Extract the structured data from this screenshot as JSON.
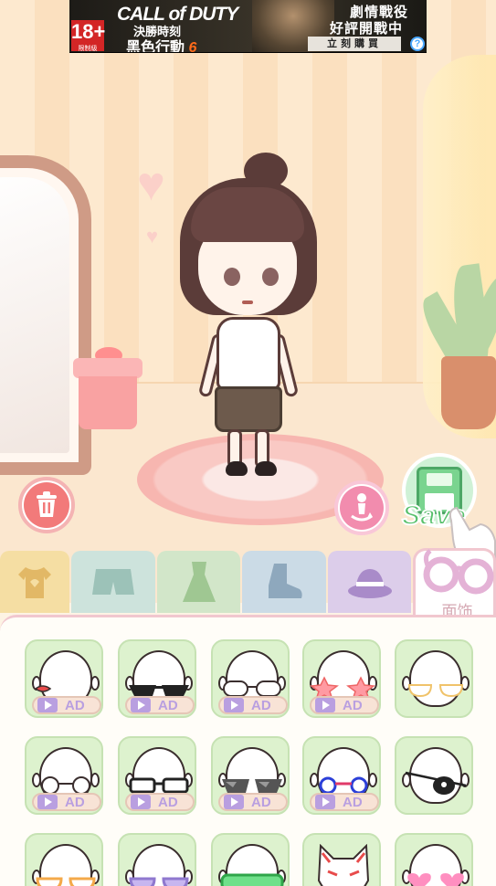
{
  "ad_banner": {
    "age_rating": "18+",
    "age_subtext": "限制級",
    "game_title": "CALL of DUTY",
    "game_subtitle": "決勝時刻",
    "game_line": "黑色行動",
    "game_number": "6",
    "tagline_1": "劇情戰役",
    "tagline_2": "好評開戰中",
    "cta": "立刻購買",
    "help": "?"
  },
  "actions": {
    "save_label": "Save"
  },
  "tabs": [
    {
      "name": "tops",
      "icon": "shirt-icon",
      "color": "#f3d99a"
    },
    {
      "name": "bottoms",
      "icon": "shorts-icon",
      "color": "#c9e0d8"
    },
    {
      "name": "dresses",
      "icon": "dress-icon",
      "color": "#cfe2c6"
    },
    {
      "name": "shoes",
      "icon": "boot-icon",
      "color": "#c9d9e4"
    },
    {
      "name": "hats",
      "icon": "hat-icon",
      "color": "#d9cbe9"
    },
    {
      "name": "face-accessories",
      "icon": "glasses-icon",
      "label": "面饰",
      "active": true
    }
  ],
  "ad_tag_label": "AD",
  "items": [
    {
      "accessory": "red-eye-patch-small",
      "ad": true
    },
    {
      "accessory": "black-sunglasses",
      "ad": true
    },
    {
      "accessory": "clear-round-glasses",
      "ad": true
    },
    {
      "accessory": "pink-star-glasses",
      "ad": true
    },
    {
      "accessory": "yellow-outline-glasses",
      "ad": false
    },
    {
      "accessory": "round-wire-glasses",
      "ad": true
    },
    {
      "accessory": "black-frame-glasses",
      "ad": true
    },
    {
      "accessory": "gray-sunglasses",
      "ad": true
    },
    {
      "accessory": "blue-red-glasses",
      "ad": true
    },
    {
      "accessory": "skull-eye-patch",
      "ad": false
    },
    {
      "accessory": "orange-glasses",
      "ad": false
    },
    {
      "accessory": "purple-glasses",
      "ad": false
    },
    {
      "accessory": "green-goggles",
      "ad": false
    },
    {
      "accessory": "fox-mask",
      "ad": false
    },
    {
      "accessory": "pink-heart-glasses",
      "ad": false
    }
  ]
}
